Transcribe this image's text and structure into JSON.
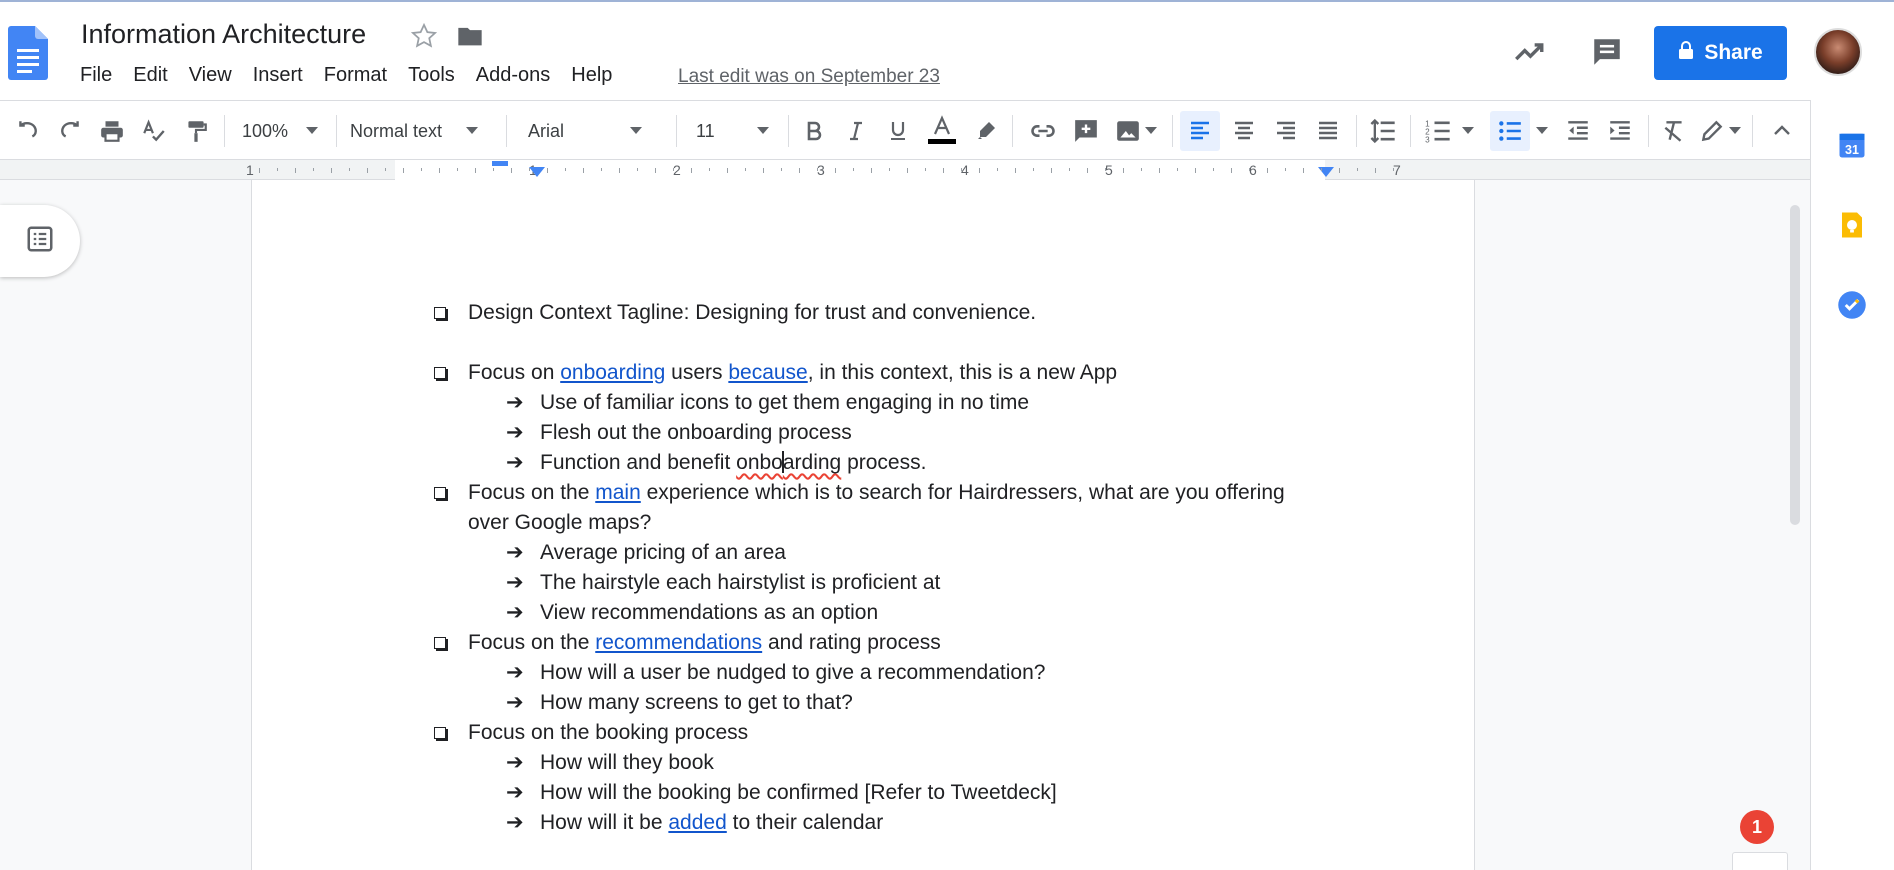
{
  "header": {
    "title": "Information Architecture",
    "menu": [
      "File",
      "Edit",
      "View",
      "Insert",
      "Format",
      "Tools",
      "Add-ons",
      "Help"
    ],
    "last_edit": "Last edit was on September 23",
    "share_label": "Share"
  },
  "toolbar": {
    "zoom": "100%",
    "style": "Normal text",
    "font": "Arial",
    "font_size": "11"
  },
  "ruler": {
    "numbers": [
      "1",
      "1",
      "2",
      "3",
      "4",
      "5",
      "6",
      "7"
    ]
  },
  "document": {
    "l1": "Design Context Tagline: Designing for trust and convenience.",
    "l2": {
      "a": "Focus on ",
      "b": "onboarding",
      "c": " users ",
      "d": "because",
      "e": ", in this context, this is a new App"
    },
    "l3": "Use of familiar icons to get them engaging in no time",
    "l4": "Flesh out the onboarding process",
    "l5": {
      "a": "Function and benefit ",
      "b": "onbo",
      "c": "arding",
      "d": " process."
    },
    "l6": {
      "a": "Focus on the ",
      "b": "main",
      "c": " experience which is to search for Hairdressers, what are you offering"
    },
    "l7": "over Google maps?",
    "l8": "Average pricing of an area",
    "l9": "The hairstyle each hairstylist is proficient at",
    "l10": "View recommendations as an option",
    "l11": {
      "a": "Focus on the ",
      "b": "recommendations",
      "c": " and rating process"
    },
    "l12": "How will a user be nudged to give a recommendation?",
    "l13": "How many screens to get to that?",
    "l14": "Focus on the booking process",
    "l15": "How will they book",
    "l16": "How will the booking be confirmed [Refer to Tweetdeck]",
    "l17": {
      "a": "How will it be ",
      "b": "added",
      "c": " to their calendar"
    },
    "arrow": "➔"
  },
  "notifications": {
    "count": "1"
  },
  "colors": {
    "accent": "#1a73e8",
    "link": "#1155cc",
    "spell_error": "#ea4335",
    "notification": "#ea4335"
  }
}
